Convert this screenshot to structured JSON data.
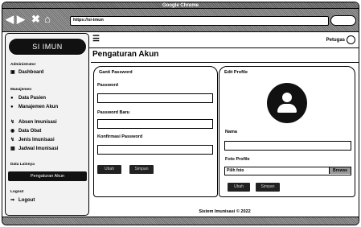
{
  "window": {
    "title": "Google Chrome"
  },
  "browser": {
    "url": "https://si-imun"
  },
  "sidebar": {
    "brand": "SI IMUN",
    "sections": {
      "admin": "Administrator",
      "manajemen": "Manajemen",
      "data_lainnya": "Data Lainnya",
      "logout": "Logout"
    },
    "items": {
      "dashboard": "Dashboard",
      "data_pasien": "Data Pasien",
      "manajemen_akun": "Manajemen Akun",
      "absen_imunisasi": "Absen Imunisasi",
      "data_obat": "Data Obat",
      "jenis_imunisasi": "Jenis Imunisasi",
      "jadwal_imunisasi": "Jadwal Imunisasi",
      "pengaturan_akun": "Pengaturan Akun",
      "logout": "Logout"
    }
  },
  "topbar": {
    "user_label": "Petugas"
  },
  "page": {
    "title": "Pengaturan Akun"
  },
  "password_card": {
    "title": "Ganti Password",
    "password_label": "Password",
    "new_password_label": "Password Baru",
    "confirm_password_label": "Konfirmasi Password",
    "submit_label": "Ubah",
    "save_label": "Simpan"
  },
  "profile_card": {
    "title": "Edit Profile",
    "name_label": "Nama",
    "photo_label": "Foto Profile",
    "file_placeholder": "Pilih foto",
    "browse_label": "Browse",
    "submit_label": "Ubah",
    "save_label": "Simpan"
  },
  "footer": {
    "text": "Sistem Imunisasi © 2022"
  },
  "icons": {
    "back": "arrow-left-icon",
    "forward": "arrow-right-icon",
    "close": "close-icon",
    "home": "home-icon",
    "menu": "hamburger-icon",
    "user": "user-icon",
    "avatar": "avatar-icon"
  }
}
